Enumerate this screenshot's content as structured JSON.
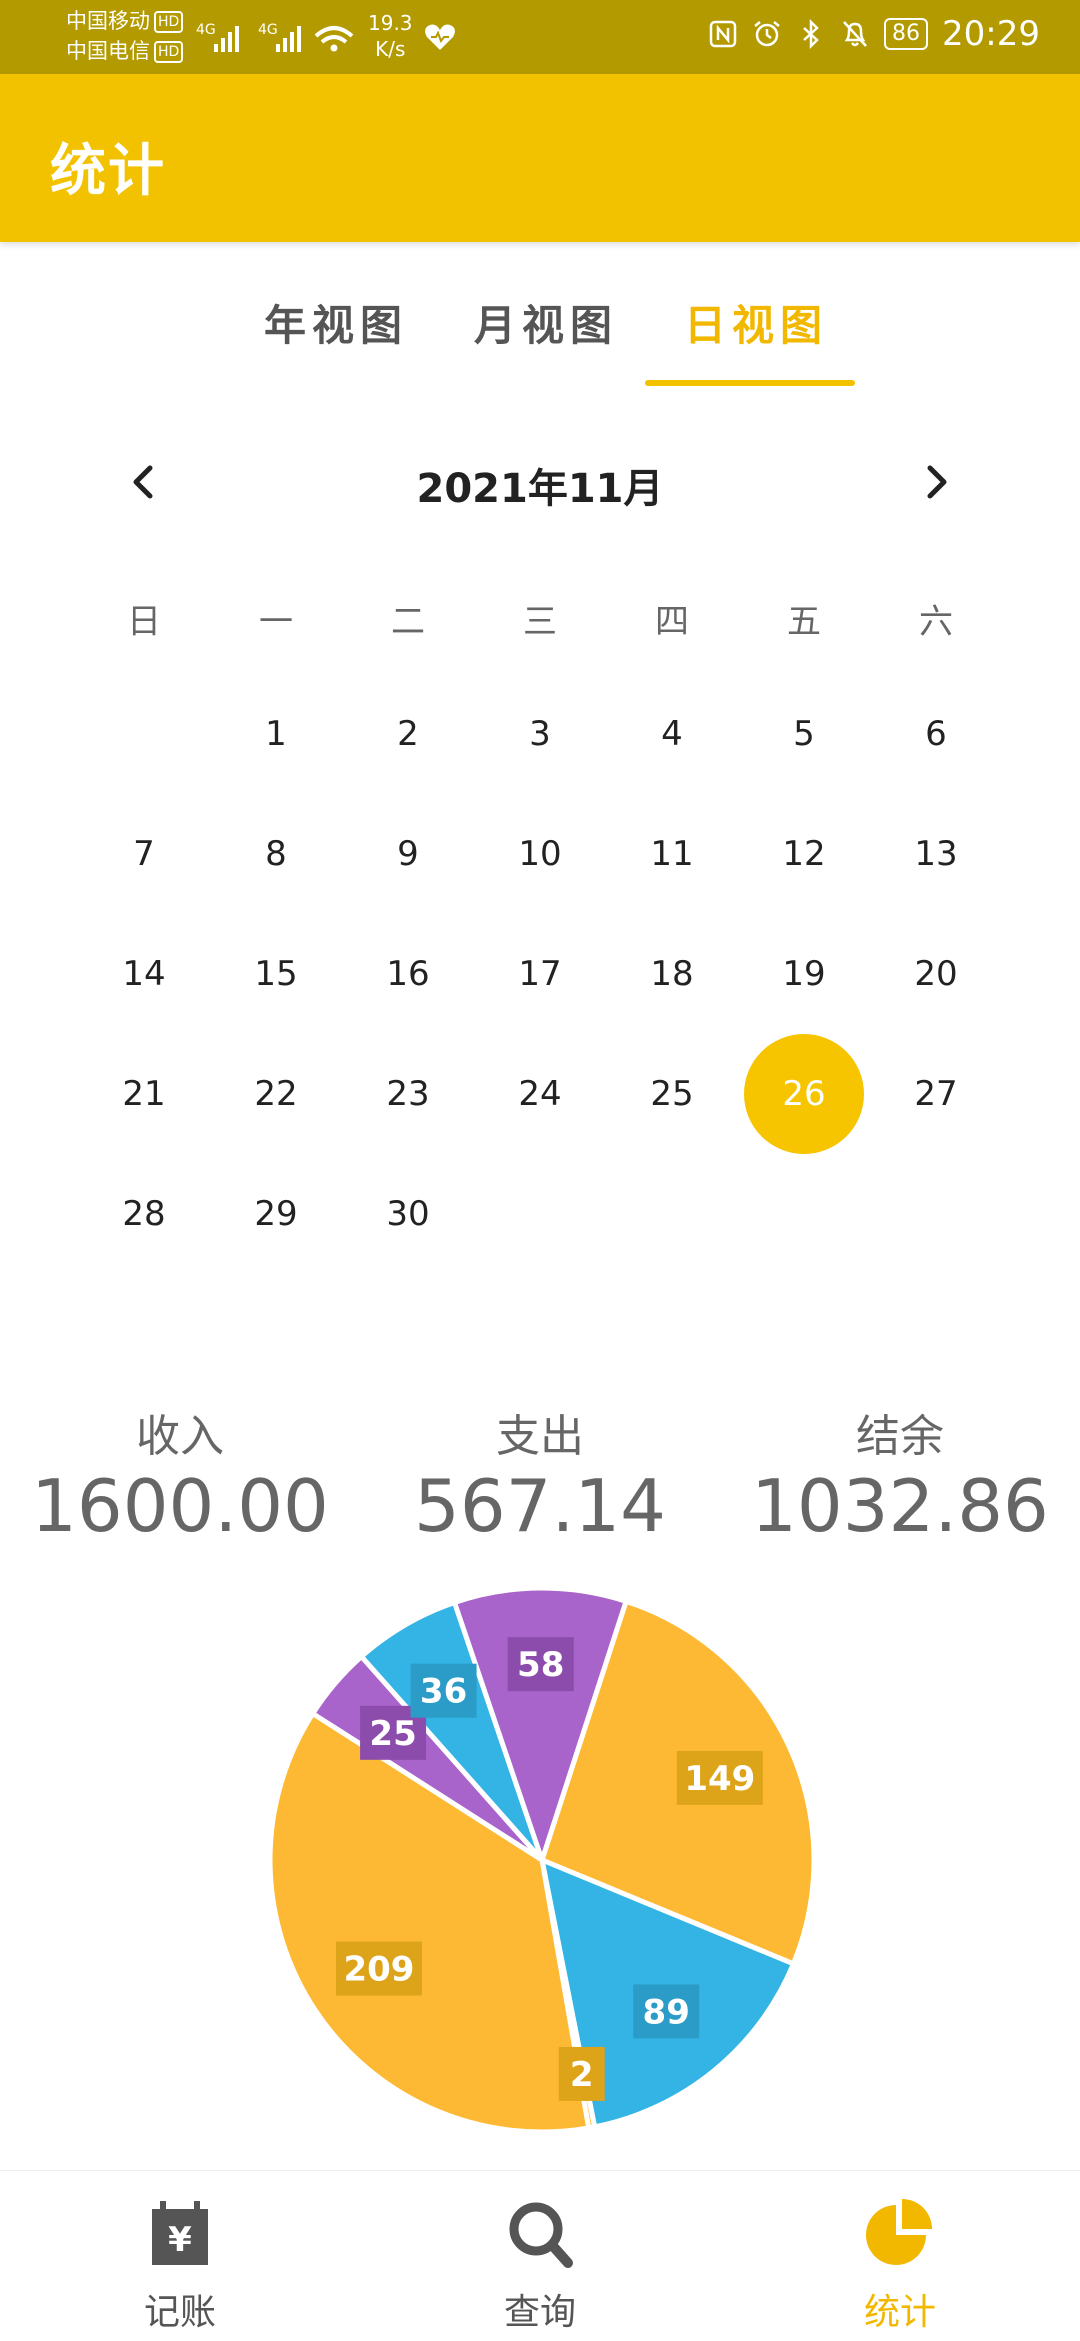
{
  "status_bar": {
    "carrier_1": "中国移动",
    "carrier_2": "中国电信",
    "hd_badge": "HD",
    "signal_1_type": "4G",
    "signal_2_type": "4G",
    "net_speed_value": "19.3",
    "net_speed_unit": "K/s",
    "battery": "86",
    "time": "20:29",
    "icons": [
      "nfc-icon",
      "alarm-icon",
      "bluetooth-icon",
      "mute-icon",
      "heart-icon",
      "wifi-icon",
      "signal-icon"
    ]
  },
  "app_bar": {
    "title": "统计"
  },
  "tabs": {
    "items": [
      {
        "label": "年视图"
      },
      {
        "label": "月视图"
      },
      {
        "label": "日视图"
      }
    ],
    "active_index": 2
  },
  "calendar": {
    "title": "2021年11月",
    "prev_icon": "chevron-left-icon",
    "next_icon": "chevron-right-icon",
    "weekdays": [
      "日",
      "一",
      "二",
      "三",
      "四",
      "五",
      "六"
    ],
    "days": [
      "1",
      "2",
      "3",
      "4",
      "5",
      "6",
      "7",
      "8",
      "9",
      "10",
      "11",
      "12",
      "13",
      "14",
      "15",
      "16",
      "17",
      "18",
      "19",
      "20",
      "21",
      "22",
      "23",
      "24",
      "25",
      "26",
      "27",
      "28",
      "29",
      "30"
    ],
    "first_weekday_offset": 1,
    "selected_day": "26"
  },
  "summary": {
    "income_label": "收入",
    "income_value": "1600.00",
    "expense_label": "支出",
    "expense_value": "567.14",
    "balance_label": "结余",
    "balance_value": "1032.86"
  },
  "chart_data": {
    "type": "pie",
    "slices": [
      {
        "value": 149,
        "color": "#fdb934"
      },
      {
        "value": 89,
        "color": "#34b4e4"
      },
      {
        "value": 2,
        "color": "#fdb934"
      },
      {
        "value": 209,
        "color": "#fdb934"
      },
      {
        "value": 25,
        "color": "#a964cb"
      },
      {
        "value": 36,
        "color": "#34b4e4"
      },
      {
        "value": 58,
        "color": "#a964cb"
      }
    ],
    "label_colors": {
      "#fdb934": "#dea419",
      "#34b4e4": "#2a9cc7",
      "#a964cb": "#8b4cab"
    }
  },
  "bottom_nav": {
    "items": [
      {
        "label": "记账",
        "icon": "ledger-icon"
      },
      {
        "label": "查询",
        "icon": "search-icon"
      },
      {
        "label": "统计",
        "icon": "pie-chart-icon"
      }
    ],
    "active_index": 2,
    "active_color": "#f2b800",
    "inactive_color": "#555555",
    "ledger_symbol": "¥"
  },
  "colors": {
    "primary": "#f2c200",
    "status_bar": "#b39a00",
    "selected_day": "#f6c500"
  }
}
